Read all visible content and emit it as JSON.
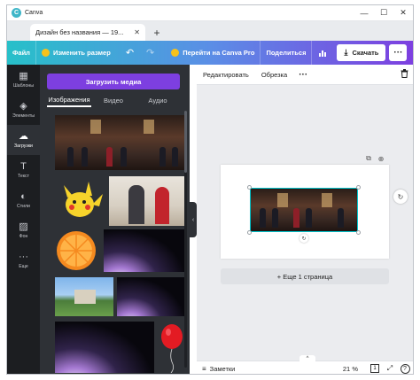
{
  "window": {
    "app_name": "Canva",
    "minimize": "—",
    "maximize": "☐",
    "close": "✕"
  },
  "tabs": [
    {
      "title": "Дизайн без названия — 19...",
      "close": "✕"
    }
  ],
  "new_tab": "+",
  "toolbar": {
    "file": "Файл",
    "resize": "Изменить размер",
    "undo": "↶",
    "redo": "↷",
    "upgrade": "Перейти на Canva Pro",
    "share": "Поделиться",
    "stats": "📊",
    "download": "Скачать",
    "more": "···"
  },
  "rail": [
    {
      "label": "Шаблоны",
      "glyph": "▦",
      "active": false
    },
    {
      "label": "Элементы",
      "glyph": "◈",
      "active": false
    },
    {
      "label": "Загрузки",
      "glyph": "☁",
      "active": true
    },
    {
      "label": "Текст",
      "glyph": "T",
      "active": false
    },
    {
      "label": "Стили",
      "glyph": "◐",
      "active": false
    },
    {
      "label": "Фон",
      "glyph": "▨",
      "active": false
    },
    {
      "label": "Еще",
      "glyph": "···",
      "active": false
    }
  ],
  "panel": {
    "upload_button": "Загрузить медиа",
    "tabs": [
      "Изображения",
      "Видео",
      "Аудио"
    ],
    "collapse": "‹"
  },
  "editor": {
    "context_items": [
      "Редактировать",
      "Обрезка"
    ],
    "context_more": "···",
    "trash": "🗑",
    "copy_icon": "⧉",
    "add_icon": "⊕",
    "rotate": "↻",
    "refresh": "↻",
    "add_page": "+ Еще 1 страница",
    "notes": "Заметки",
    "notes_icon": "≡",
    "up": "^",
    "zoom": "21 %",
    "page_count": "1",
    "fullscreen": "⤢",
    "help": "?"
  }
}
